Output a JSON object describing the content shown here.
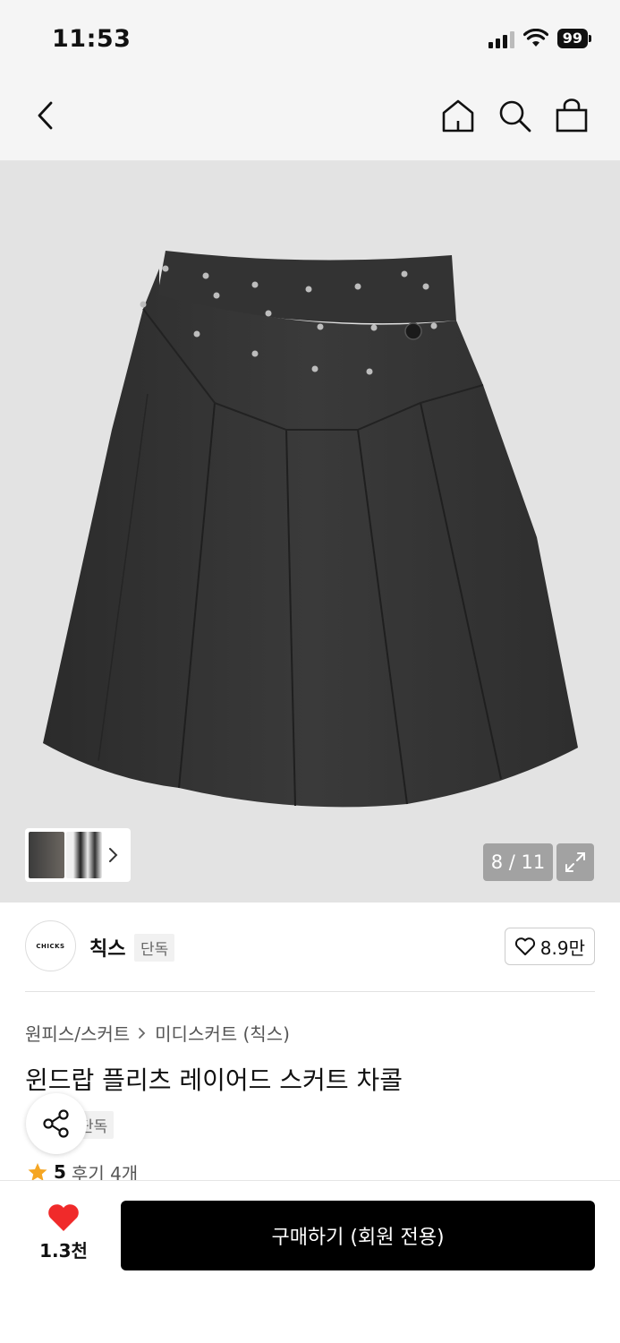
{
  "status_bar": {
    "time": "11:53",
    "battery": "99"
  },
  "nav": {
    "icons": [
      "back-icon",
      "home-icon",
      "search-icon",
      "shopping-bag-icon"
    ]
  },
  "gallery": {
    "counter": "8 / 11",
    "image": "black pleated midi skirt with studs",
    "current_index": 8,
    "total": 11
  },
  "brand": {
    "logo_text": "CHICKS",
    "name": "칙스",
    "tag": "단독",
    "like_count": "8.9만"
  },
  "product": {
    "breadcrumb": [
      "원피스/스커트",
      "미디스커트 (칙스)"
    ],
    "title": "윈드랍 플리츠 레이어드 스커트 차콜",
    "tag": "단독",
    "rating": "5",
    "reviews": "후기 4개"
  },
  "bottom_bar": {
    "wish_count": "1.3천",
    "buy_label": "구매하기 (회원 전용)"
  },
  "colors": {
    "accent_heart": "#f02a2a",
    "rating_star": "#f5a623",
    "buy_button": "#000000"
  }
}
